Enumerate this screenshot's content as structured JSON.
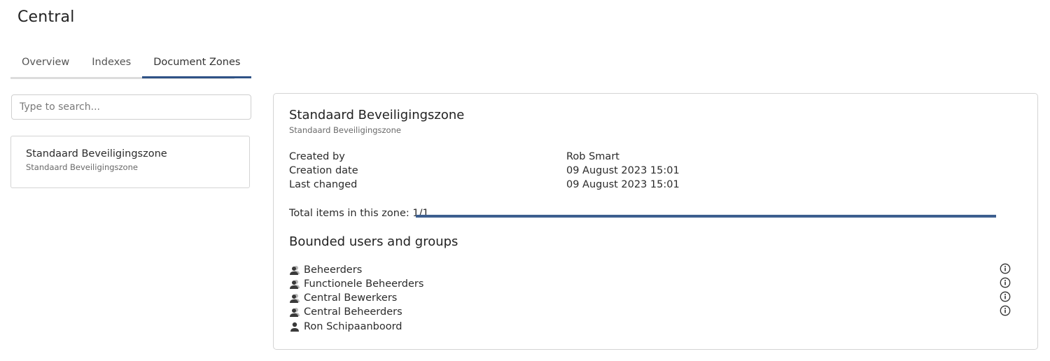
{
  "app": {
    "title": "Central"
  },
  "tabs": [
    {
      "label": "Overview",
      "active": false
    },
    {
      "label": "Indexes",
      "active": false
    },
    {
      "label": "Document Zones",
      "active": true
    }
  ],
  "search": {
    "placeholder": "Type to search...",
    "value": ""
  },
  "zone_list": [
    {
      "title": "Standaard Beveiligingszone",
      "subtitle": "Standaard Beveiligingszone"
    }
  ],
  "detail": {
    "title": "Standaard Beveiligingszone",
    "subtitle": "Standaard Beveiligingszone",
    "meta": [
      {
        "label": "Created by",
        "value": "Rob Smart"
      },
      {
        "label": "Creation date",
        "value": "09 August 2023 15:01"
      },
      {
        "label": "Last changed",
        "value": "09 August 2023 15:01"
      }
    ],
    "total_label": "Total items in this zone: 1/1",
    "progress_fraction": 1.0,
    "bounded_title": "Bounded users and groups",
    "members": [
      {
        "name": "Beheerders",
        "icon": "group-icon",
        "has_info": true
      },
      {
        "name": "Functionele Beheerders",
        "icon": "group-icon",
        "has_info": true
      },
      {
        "name": "Central Bewerkers",
        "icon": "group-icon",
        "has_info": true
      },
      {
        "name": "Central Beheerders",
        "icon": "group-icon",
        "has_info": true
      },
      {
        "name": "Ron Schipaanboord",
        "icon": "user-icon",
        "has_info": false
      }
    ]
  },
  "colors": {
    "accent": "#2f5386",
    "progress": "#3d5f8f",
    "border": "#d4d4d4"
  }
}
